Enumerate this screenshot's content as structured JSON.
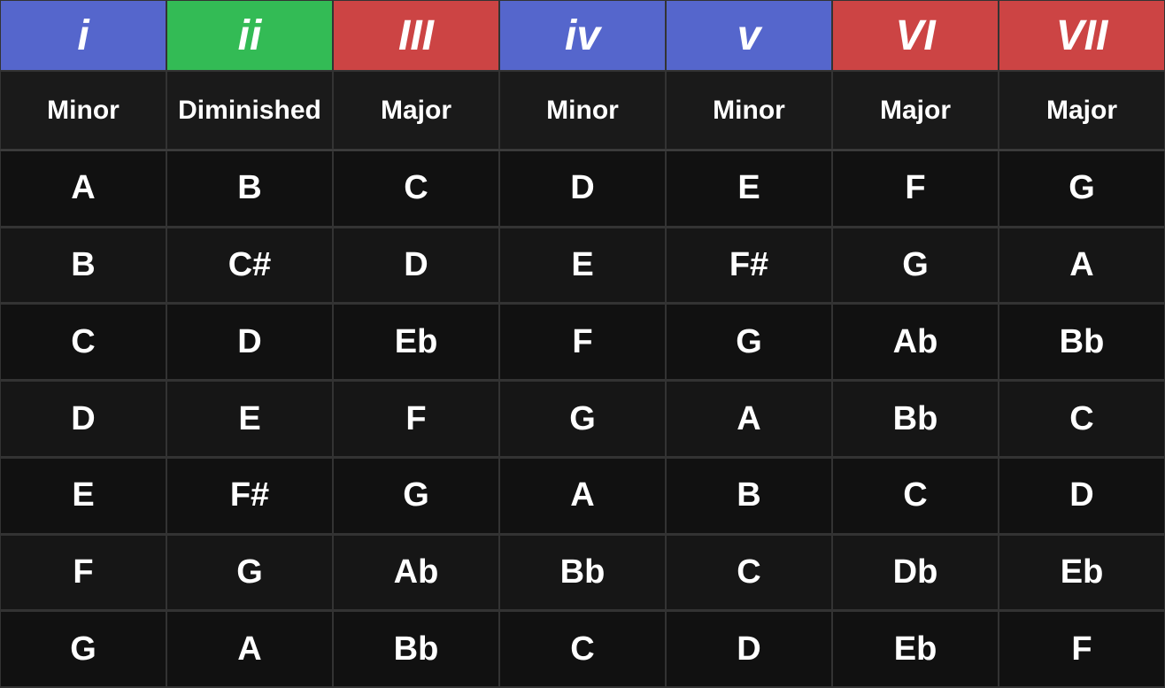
{
  "header": {
    "columns": [
      {
        "label": "i",
        "color": "blue"
      },
      {
        "label": "ii",
        "color": "green"
      },
      {
        "label": "III",
        "color": "red"
      },
      {
        "label": "iv",
        "color": "blue"
      },
      {
        "label": "v",
        "color": "blue"
      },
      {
        "label": "VI",
        "color": "red"
      },
      {
        "label": "VII",
        "color": "red"
      }
    ]
  },
  "qualities": [
    "Minor",
    "Diminished",
    "Major",
    "Minor",
    "Minor",
    "Major",
    "Major"
  ],
  "rows": [
    [
      "A",
      "B",
      "C",
      "D",
      "E",
      "F",
      "G"
    ],
    [
      "B",
      "C#",
      "D",
      "E",
      "F#",
      "G",
      "A"
    ],
    [
      "C",
      "D",
      "Eb",
      "F",
      "G",
      "Ab",
      "Bb"
    ],
    [
      "D",
      "E",
      "F",
      "G",
      "A",
      "Bb",
      "C"
    ],
    [
      "E",
      "F#",
      "G",
      "A",
      "B",
      "C",
      "D"
    ],
    [
      "F",
      "G",
      "Ab",
      "Bb",
      "C",
      "Db",
      "Eb"
    ],
    [
      "G",
      "A",
      "Bb",
      "C",
      "D",
      "Eb",
      "F"
    ]
  ]
}
